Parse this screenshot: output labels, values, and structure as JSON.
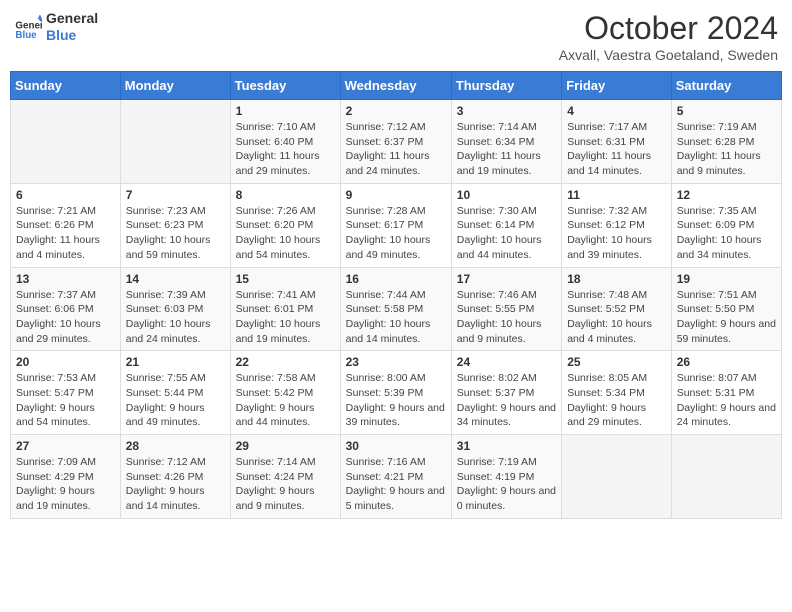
{
  "header": {
    "logo_line1": "General",
    "logo_line2": "Blue",
    "month": "October 2024",
    "location": "Axvall, Vaestra Goetaland, Sweden"
  },
  "days_of_week": [
    "Sunday",
    "Monday",
    "Tuesday",
    "Wednesday",
    "Thursday",
    "Friday",
    "Saturday"
  ],
  "weeks": [
    [
      {
        "day": "",
        "content": ""
      },
      {
        "day": "",
        "content": ""
      },
      {
        "day": "1",
        "content": "Sunrise: 7:10 AM\nSunset: 6:40 PM\nDaylight: 11 hours and 29 minutes."
      },
      {
        "day": "2",
        "content": "Sunrise: 7:12 AM\nSunset: 6:37 PM\nDaylight: 11 hours and 24 minutes."
      },
      {
        "day": "3",
        "content": "Sunrise: 7:14 AM\nSunset: 6:34 PM\nDaylight: 11 hours and 19 minutes."
      },
      {
        "day": "4",
        "content": "Sunrise: 7:17 AM\nSunset: 6:31 PM\nDaylight: 11 hours and 14 minutes."
      },
      {
        "day": "5",
        "content": "Sunrise: 7:19 AM\nSunset: 6:28 PM\nDaylight: 11 hours and 9 minutes."
      }
    ],
    [
      {
        "day": "6",
        "content": "Sunrise: 7:21 AM\nSunset: 6:26 PM\nDaylight: 11 hours and 4 minutes."
      },
      {
        "day": "7",
        "content": "Sunrise: 7:23 AM\nSunset: 6:23 PM\nDaylight: 10 hours and 59 minutes."
      },
      {
        "day": "8",
        "content": "Sunrise: 7:26 AM\nSunset: 6:20 PM\nDaylight: 10 hours and 54 minutes."
      },
      {
        "day": "9",
        "content": "Sunrise: 7:28 AM\nSunset: 6:17 PM\nDaylight: 10 hours and 49 minutes."
      },
      {
        "day": "10",
        "content": "Sunrise: 7:30 AM\nSunset: 6:14 PM\nDaylight: 10 hours and 44 minutes."
      },
      {
        "day": "11",
        "content": "Sunrise: 7:32 AM\nSunset: 6:12 PM\nDaylight: 10 hours and 39 minutes."
      },
      {
        "day": "12",
        "content": "Sunrise: 7:35 AM\nSunset: 6:09 PM\nDaylight: 10 hours and 34 minutes."
      }
    ],
    [
      {
        "day": "13",
        "content": "Sunrise: 7:37 AM\nSunset: 6:06 PM\nDaylight: 10 hours and 29 minutes."
      },
      {
        "day": "14",
        "content": "Sunrise: 7:39 AM\nSunset: 6:03 PM\nDaylight: 10 hours and 24 minutes."
      },
      {
        "day": "15",
        "content": "Sunrise: 7:41 AM\nSunset: 6:01 PM\nDaylight: 10 hours and 19 minutes."
      },
      {
        "day": "16",
        "content": "Sunrise: 7:44 AM\nSunset: 5:58 PM\nDaylight: 10 hours and 14 minutes."
      },
      {
        "day": "17",
        "content": "Sunrise: 7:46 AM\nSunset: 5:55 PM\nDaylight: 10 hours and 9 minutes."
      },
      {
        "day": "18",
        "content": "Sunrise: 7:48 AM\nSunset: 5:52 PM\nDaylight: 10 hours and 4 minutes."
      },
      {
        "day": "19",
        "content": "Sunrise: 7:51 AM\nSunset: 5:50 PM\nDaylight: 9 hours and 59 minutes."
      }
    ],
    [
      {
        "day": "20",
        "content": "Sunrise: 7:53 AM\nSunset: 5:47 PM\nDaylight: 9 hours and 54 minutes."
      },
      {
        "day": "21",
        "content": "Sunrise: 7:55 AM\nSunset: 5:44 PM\nDaylight: 9 hours and 49 minutes."
      },
      {
        "day": "22",
        "content": "Sunrise: 7:58 AM\nSunset: 5:42 PM\nDaylight: 9 hours and 44 minutes."
      },
      {
        "day": "23",
        "content": "Sunrise: 8:00 AM\nSunset: 5:39 PM\nDaylight: 9 hours and 39 minutes."
      },
      {
        "day": "24",
        "content": "Sunrise: 8:02 AM\nSunset: 5:37 PM\nDaylight: 9 hours and 34 minutes."
      },
      {
        "day": "25",
        "content": "Sunrise: 8:05 AM\nSunset: 5:34 PM\nDaylight: 9 hours and 29 minutes."
      },
      {
        "day": "26",
        "content": "Sunrise: 8:07 AM\nSunset: 5:31 PM\nDaylight: 9 hours and 24 minutes."
      }
    ],
    [
      {
        "day": "27",
        "content": "Sunrise: 7:09 AM\nSunset: 4:29 PM\nDaylight: 9 hours and 19 minutes."
      },
      {
        "day": "28",
        "content": "Sunrise: 7:12 AM\nSunset: 4:26 PM\nDaylight: 9 hours and 14 minutes."
      },
      {
        "day": "29",
        "content": "Sunrise: 7:14 AM\nSunset: 4:24 PM\nDaylight: 9 hours and 9 minutes."
      },
      {
        "day": "30",
        "content": "Sunrise: 7:16 AM\nSunset: 4:21 PM\nDaylight: 9 hours and 5 minutes."
      },
      {
        "day": "31",
        "content": "Sunrise: 7:19 AM\nSunset: 4:19 PM\nDaylight: 9 hours and 0 minutes."
      },
      {
        "day": "",
        "content": ""
      },
      {
        "day": "",
        "content": ""
      }
    ]
  ]
}
